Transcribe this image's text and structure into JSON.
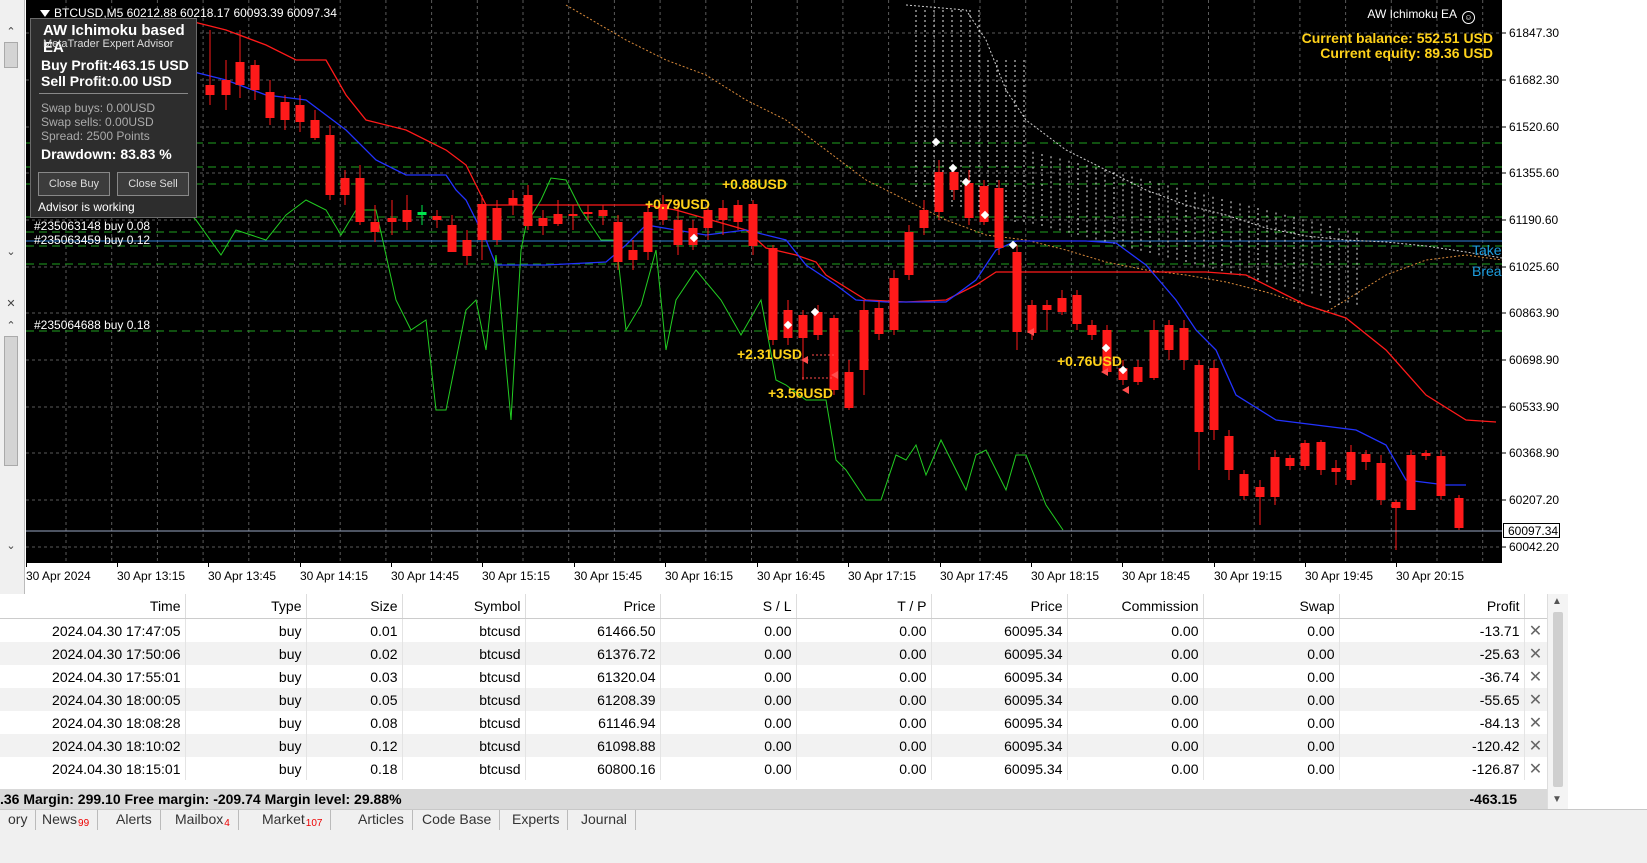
{
  "chart": {
    "title": "BTCUSD,M5  60212.88 60218.17 60093.39 60097.34",
    "ea_name": "AW Ichimoku EA",
    "balance": "Current balance: 552.51 USD",
    "equity": "Current equity: 89.36 USD",
    "price_axis": [
      "61847.30",
      "61682.30",
      "61520.60",
      "61355.60",
      "61190.60",
      "61025.60",
      "60863.90",
      "60698.90",
      "60533.90",
      "60368.90",
      "60207.20",
      "60042.20"
    ],
    "current_price": "60097.34",
    "time_axis": [
      "30 Apr 2024",
      "30 Apr 13:15",
      "30 Apr 13:45",
      "30 Apr 14:15",
      "30 Apr 14:45",
      "30 Apr 15:15",
      "30 Apr 15:45",
      "30 Apr 16:15",
      "30 Apr 16:45",
      "30 Apr 17:15",
      "30 Apr 17:45",
      "30 Apr 18:15",
      "30 Apr 18:45",
      "30 Apr 19:15",
      "30 Apr 19:45",
      "30 Apr 20:15"
    ],
    "orders": [
      "#235063148 buy 0.08",
      "#235063459 buy 0.12",
      "#235064688 buy 0.18"
    ],
    "profits": [
      "+0.88USD",
      "+0.79USD",
      "+2.31USD",
      "+3.56USD",
      "+0.76USD"
    ],
    "right_texts": [
      "Take",
      "Brea"
    ],
    "colors": {
      "background": "#000000",
      "bull": "#00e64d",
      "bear": "#ff1a1a",
      "tenkan": "#ff1a1a",
      "kijun": "#2233ff",
      "chikou": "#22cc22",
      "grid": "#5a5a5a",
      "levels": "#1f9f1f",
      "accent": "#ffd21a"
    }
  },
  "ea_panel": {
    "title": "AW Ichimoku based EA",
    "subtitle": "MetaTrader Expert Advisor",
    "buy_profit": "Buy Profit:463.15 USD",
    "sell_profit": "Sell Profit:0.00 USD",
    "swap_buys": "Swap buys: 0.00USD",
    "swap_sells": "Swap sells: 0.00USD",
    "spread": "Spread: 2500 Points",
    "drawdown": "Drawdown: 83.83 %",
    "close_buy": "Close Buy",
    "close_sell": "Close Sell",
    "status": "Advisor is working"
  },
  "terminal": {
    "columns": [
      "Time",
      "Type",
      "Size",
      "Symbol",
      "Price",
      "S / L",
      "T / P",
      "Price",
      "Commission",
      "Swap",
      "Profit",
      ""
    ],
    "rows": [
      [
        "2024.04.30 17:47:05",
        "buy",
        "0.01",
        "btcusd",
        "61466.50",
        "0.00",
        "0.00",
        "60095.34",
        "0.00",
        "0.00",
        "-13.71"
      ],
      [
        "2024.04.30 17:50:06",
        "buy",
        "0.02",
        "btcusd",
        "61376.72",
        "0.00",
        "0.00",
        "60095.34",
        "0.00",
        "0.00",
        "-25.63"
      ],
      [
        "2024.04.30 17:55:01",
        "buy",
        "0.03",
        "btcusd",
        "61320.04",
        "0.00",
        "0.00",
        "60095.34",
        "0.00",
        "0.00",
        "-36.74"
      ],
      [
        "2024.04.30 18:00:05",
        "buy",
        "0.05",
        "btcusd",
        "61208.39",
        "0.00",
        "0.00",
        "60095.34",
        "0.00",
        "0.00",
        "-55.65"
      ],
      [
        "2024.04.30 18:08:28",
        "buy",
        "0.08",
        "btcusd",
        "61146.94",
        "0.00",
        "0.00",
        "60095.34",
        "0.00",
        "0.00",
        "-84.13"
      ],
      [
        "2024.04.30 18:10:02",
        "buy",
        "0.12",
        "btcusd",
        "61098.88",
        "0.00",
        "0.00",
        "60095.34",
        "0.00",
        "0.00",
        "-120.42"
      ],
      [
        "2024.04.30 18:15:01",
        "buy",
        "0.18",
        "btcusd",
        "60800.16",
        "0.00",
        "0.00",
        "60095.34",
        "0.00",
        "0.00",
        "-126.87"
      ]
    ],
    "summary": ".36  Margin: 299.10  Free margin: -209.74  Margin level: 29.88%",
    "summary_total": "-463.15",
    "tabs": [
      {
        "label": "ory",
        "badge": ""
      },
      {
        "label": "News",
        "badge": "99"
      },
      {
        "label": "Alerts",
        "badge": ""
      },
      {
        "label": "Mailbox",
        "badge": "4"
      },
      {
        "label": "Market",
        "badge": "107"
      },
      {
        "label": "Articles",
        "badge": ""
      },
      {
        "label": "Code Base",
        "badge": ""
      },
      {
        "label": "Experts",
        "badge": ""
      },
      {
        "label": "Journal",
        "badge": ""
      }
    ]
  }
}
